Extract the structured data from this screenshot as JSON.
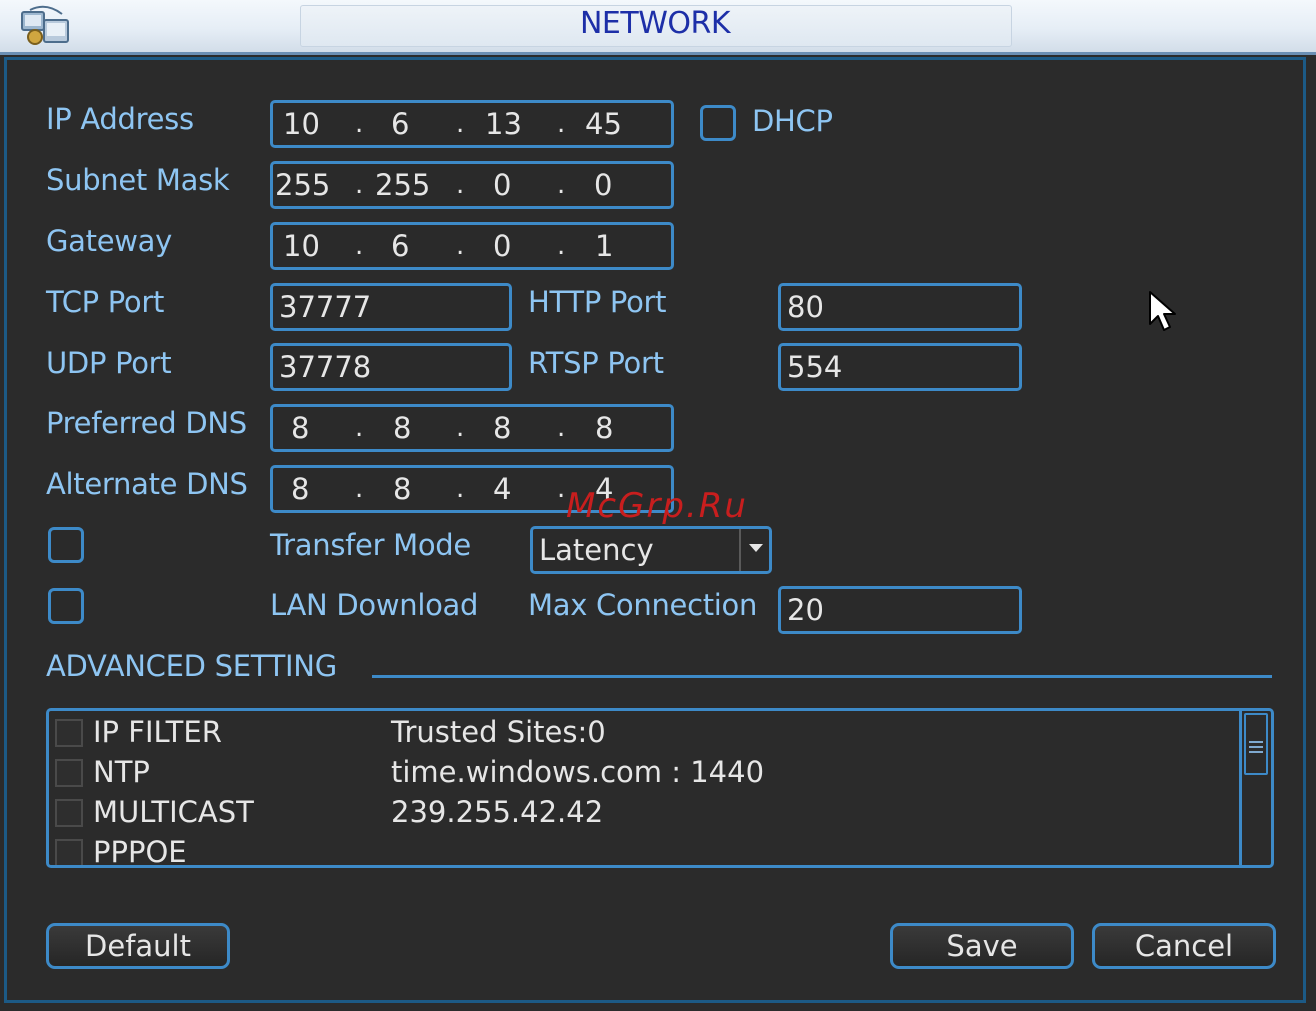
{
  "window": {
    "title": "NETWORK"
  },
  "form": {
    "ip_address": {
      "label": "IP Address",
      "octets": [
        "10",
        "6",
        "13",
        "45"
      ]
    },
    "dhcp": {
      "label": "DHCP",
      "checked": false
    },
    "subnet_mask": {
      "label": "Subnet Mask",
      "octets": [
        "255",
        "255",
        "0",
        "0"
      ]
    },
    "gateway": {
      "label": "Gateway",
      "octets": [
        "10",
        "6",
        "0",
        "1"
      ]
    },
    "tcp_port": {
      "label": "TCP Port",
      "value": "37777"
    },
    "http_port": {
      "label": "HTTP Port",
      "value": "80"
    },
    "udp_port": {
      "label": "UDP Port",
      "value": "37778"
    },
    "rtsp_port": {
      "label": "RTSP Port",
      "value": "554"
    },
    "preferred_dns": {
      "label": "Preferred DNS",
      "octets": [
        "8",
        "8",
        "8",
        "8"
      ]
    },
    "alternate_dns": {
      "label": "Alternate DNS",
      "octets": [
        "8",
        "8",
        "4",
        "4"
      ]
    },
    "transfer_mode": {
      "label": "Transfer Mode",
      "value": "Latency",
      "checked": false
    },
    "lan_download": {
      "label": "LAN Download",
      "checked": false
    },
    "max_connection": {
      "label": "Max Connection",
      "value": "20"
    }
  },
  "advanced": {
    "heading": "ADVANCED SETTING",
    "items": [
      {
        "name": "IP FILTER",
        "value": "Trusted Sites:0"
      },
      {
        "name": "NTP",
        "value": "time.windows.com : 1440"
      },
      {
        "name": "MULTICAST",
        "value": "239.255.42.42"
      },
      {
        "name": "PPPOE",
        "value": ""
      }
    ]
  },
  "buttons": {
    "default": "Default",
    "save": "Save",
    "cancel": "Cancel"
  },
  "watermark": "McGrp.Ru",
  "colors": {
    "accent": "#3d8ac8",
    "label": "#8ec5f2",
    "title": "#1d2fa8",
    "background": "#2b2b2b"
  }
}
